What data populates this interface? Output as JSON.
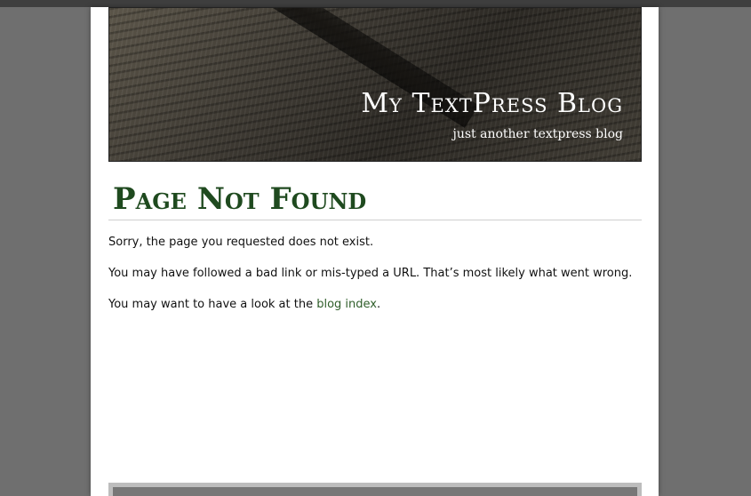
{
  "header": {
    "site_title": "My TextPress Blog",
    "tagline": "just another textpress blog"
  },
  "content": {
    "title": "Page Not Found",
    "paragraph1": "Sorry, the page you requested does not exist.",
    "paragraph2": "You may have followed a bad link or mis-typed a URL. That’s most likely what went wrong.",
    "paragraph3_prefix": "You may want to have a look at the ",
    "paragraph3_link": "blog index",
    "paragraph3_suffix": "."
  },
  "colors": {
    "title": "#1f4a1f",
    "link": "#2f5e2a",
    "background": "#6f6f6f"
  }
}
